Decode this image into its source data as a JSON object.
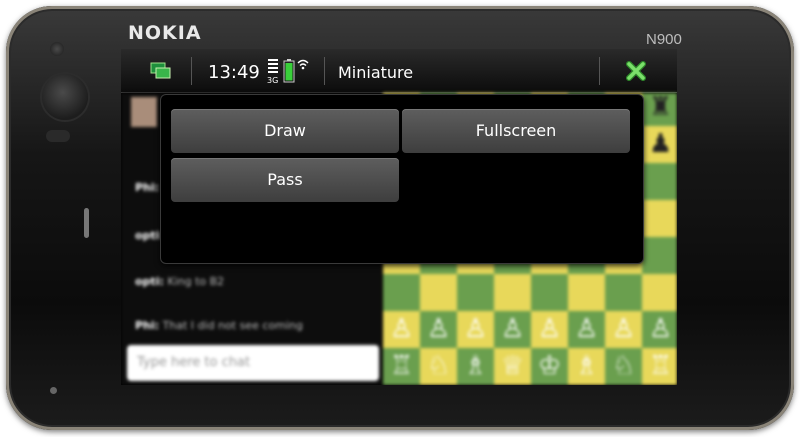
{
  "device": {
    "brand": "NOKIA",
    "model": "N900"
  },
  "statusbar": {
    "time": "13:49",
    "network": "3G",
    "title": "Miniature"
  },
  "menu": {
    "items": [
      "Draw",
      "Fullscreen",
      "Pass"
    ]
  },
  "chat": {
    "messages": [
      {
        "user": "Phi:",
        "text": "..."
      },
      {
        "user": "opti:",
        "text": "..."
      },
      {
        "user": "opti:",
        "text": "King to B2"
      },
      {
        "user": "Phi:",
        "text": "That I did not see coming"
      }
    ],
    "input_placeholder": "Type here to chat"
  },
  "colors": {
    "board_light": "#e8d85a",
    "board_dark": "#6a9f4e",
    "accent_green": "#39b54a"
  }
}
